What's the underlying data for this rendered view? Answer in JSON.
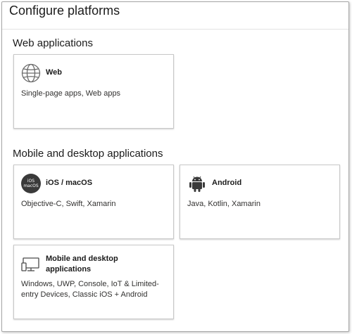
{
  "header": {
    "title": "Configure platforms"
  },
  "sections": {
    "web": {
      "title": "Web applications"
    },
    "mobile": {
      "title": "Mobile and desktop applications"
    }
  },
  "cards": {
    "web": {
      "name": "Web",
      "description": "Single-page apps, Web apps",
      "icon": "globe-icon"
    },
    "ios": {
      "name": "iOS / macOS",
      "description": "Objective-C, Swift, Xamarin",
      "icon": "ios-macos-icon",
      "badge_line1": "iOS",
      "badge_line2": "macOS"
    },
    "android": {
      "name": "Android",
      "description": "Java, Kotlin, Xamarin",
      "icon": "android-icon"
    },
    "desktop": {
      "name": "Mobile and desktop applications",
      "description": "Windows, UWP, Console, IoT & Limited-entry Devices, Classic iOS + Android",
      "icon": "desktop-icon"
    }
  },
  "colors": {
    "border": "#c8c8c8",
    "text": "#1b1b1b",
    "icon": "#3a3a3a"
  }
}
